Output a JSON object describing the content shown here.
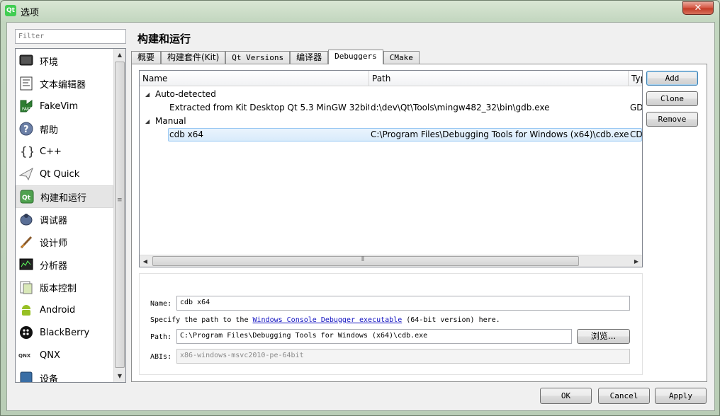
{
  "window": {
    "title": "选项",
    "app_icon": "Qt",
    "close_label": "✕"
  },
  "sidebar": {
    "filter_placeholder": "Filter",
    "items": [
      {
        "label": "环境",
        "icon": "monitor-icon"
      },
      {
        "label": "文本编辑器",
        "icon": "text-editor-icon"
      },
      {
        "label": "FakeVim",
        "icon": "fakevim-icon"
      },
      {
        "label": "帮助",
        "icon": "help-icon"
      },
      {
        "label": "C++",
        "icon": "cpp-braces-icon"
      },
      {
        "label": "Qt Quick",
        "icon": "paper-plane-icon"
      },
      {
        "label": "构建和运行",
        "icon": "build-run-icon"
      },
      {
        "label": "调试器",
        "icon": "debugger-icon"
      },
      {
        "label": "设计师",
        "icon": "designer-brush-icon"
      },
      {
        "label": "分析器",
        "icon": "analyzer-icon"
      },
      {
        "label": "版本控制",
        "icon": "version-control-icon"
      },
      {
        "label": "Android",
        "icon": "android-icon"
      },
      {
        "label": "BlackBerry",
        "icon": "blackberry-icon"
      },
      {
        "label": "QNX",
        "icon": "qnx-icon"
      },
      {
        "label": "设备",
        "icon": "devices-icon"
      }
    ],
    "selected_index": 6
  },
  "main": {
    "title": "构建和运行",
    "tabs": [
      "概要",
      "构建套件(Kit)",
      "Qt Versions",
      "编译器",
      "Debuggers",
      "CMake"
    ],
    "active_tab": 4
  },
  "debuggers": {
    "columns": [
      "Name",
      "Path",
      "Type"
    ],
    "groups": [
      {
        "label": "Auto-detected",
        "rows": [
          {
            "name": "Extracted from Kit Desktop Qt 5.3 MinGW 32bit",
            "path": "d:\\dev\\Qt\\Tools\\mingw482_32\\bin\\gdb.exe",
            "type": "GDB"
          }
        ]
      },
      {
        "label": "Manual",
        "rows": [
          {
            "name": "cdb x64",
            "path": "C:\\Program Files\\Debugging Tools for Windows (x64)\\cdb.exe",
            "type": "CDB"
          }
        ]
      }
    ],
    "buttons": {
      "add": "Add",
      "clone": "Clone",
      "remove": "Remove"
    }
  },
  "details": {
    "name_label": "Name:",
    "name_value": "cdb x64",
    "hint_prefix": "Specify the path to the ",
    "hint_link": "Windows Console Debugger executable",
    "hint_suffix": " (64-bit version) here.",
    "path_label": "Path:",
    "path_value": "C:\\Program Files\\Debugging Tools for Windows (x64)\\cdb.exe",
    "browse_label": "浏览...",
    "abis_label": "ABIs:",
    "abis_value": "x86-windows-msvc2010-pe-64bit"
  },
  "footer": {
    "ok": "OK",
    "cancel": "Cancel",
    "apply": "Apply"
  }
}
